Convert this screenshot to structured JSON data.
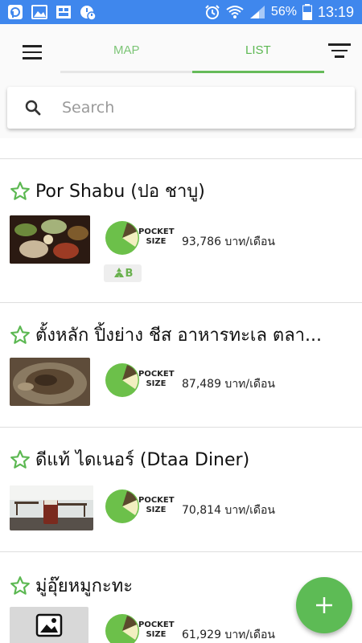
{
  "status_bar": {
    "battery": "56%",
    "time": "13:19"
  },
  "tabs": {
    "map": "MAP",
    "list": "LIST"
  },
  "search": {
    "placeholder": "Search"
  },
  "colors": {
    "accent": "#5dbb55",
    "status_bar": "#3f87ed",
    "star": "#5cb852"
  },
  "restaurants": [
    {
      "name": "Por Shabu (ปอ ชาบู)",
      "size_label": [
        "POCKET",
        "SIZE"
      ],
      "income": "93,786 บาท/เดือน",
      "badge": "B",
      "badge_icon": "recycle-icon",
      "image": "hotpot-table-photo"
    },
    {
      "name": "ตั้งหลัก ปิ้งย่าง ชีส อาหารทะเล ตลา...",
      "size_label": [
        "POCKET",
        "SIZE"
      ],
      "income": "87,489 บาท/เดือน",
      "image": "grill-pan-photo"
    },
    {
      "name": "ดีแท้ ไดเนอร์ (Dtaa Diner)",
      "size_label": [
        "POCKET",
        "SIZE"
      ],
      "income": "70,814 บาท/เดือน",
      "image": "iced-drink-photo"
    },
    {
      "name": "มู่อุ๊ยหมูกะทะ",
      "size_label": [
        "POCKET",
        "SIZE"
      ],
      "income": "61,929 บาท/เดือน",
      "image": "image-placeholder"
    }
  ],
  "fab": {
    "icon": "plus-icon"
  }
}
